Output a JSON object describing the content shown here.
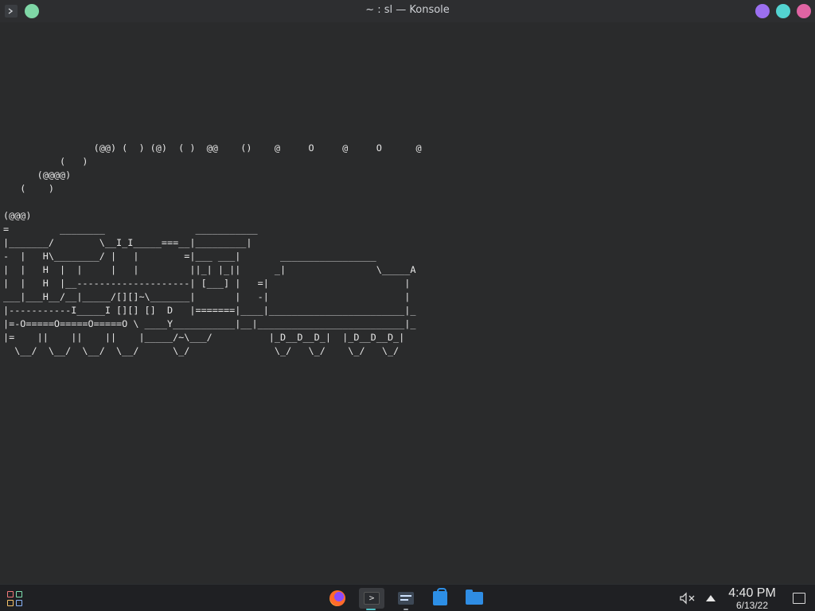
{
  "window": {
    "title": "~ : sl — Konsole"
  },
  "terminal": {
    "lines": [
      "                (@@) (  ) (@)  ( )  @@    ()    @     O     @     O      @",
      "          (   )",
      "      (@@@@)",
      "   (    )",
      "",
      "(@@@)",
      "=         ________                ___________",
      "|_______/        \\__I_I_____===__|_________|",
      "-  |   H\\________/ |   |        =|___ ___|       _________________",
      "|  |   H  |  |     |   |         ||_| |_||      _|                \\_____A",
      "|  |   H  |__--------------------| [___] |   =|                        |",
      "___|___H__/__|_____/[][]~\\_______|       |   -|                        |",
      "|-----------I_____I [][] []  D   |=======|____|________________________|_",
      "|=-O=====O=====O=====O \\ ____Y___________|__|__________________________|_",
      "|=    ||    ||    ||    |_____/~\\___/          |_D__D__D_|  |_D__D__D_|",
      "  \\__/  \\__/  \\__/  \\__/      \\_/               \\_/   \\_/    \\_/   \\_/"
    ]
  },
  "taskbar": {
    "time": "4:40 PM",
    "date": "6/13/22"
  },
  "colors": {
    "terminal_bg": "#2a2b2c",
    "text": "#e6e6e6",
    "minimize": "#9b6ff0",
    "maximize": "#53d3d1",
    "close": "#e064a3",
    "pin": "#7fd7a6"
  }
}
